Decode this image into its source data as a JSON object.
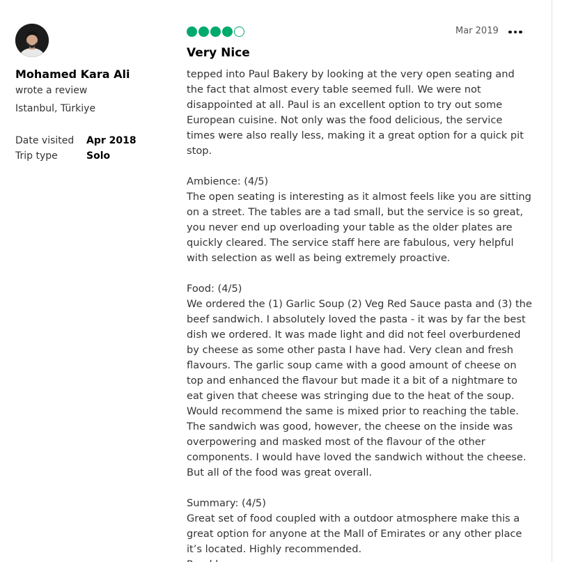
{
  "reviewer": {
    "name": "Mohamed Kara Ali",
    "action": "wrote a review",
    "location": "Istanbul, Türkiye",
    "avatar_icon": "user-avatar-photo",
    "details": [
      {
        "label": "Date visited",
        "value": "Apr 2018"
      },
      {
        "label": "Trip type",
        "value": "Solo"
      }
    ]
  },
  "review": {
    "rating": 4,
    "rating_max": 5,
    "rating_color": "#00aa6c",
    "date": "Mar 2019",
    "more_icon": "more-horizontal-icon",
    "title": "Very Nice",
    "paragraphs": [
      [
        "tepped into Paul Bakery by looking at the very open seating and",
        "the fact that almost every table seemed full. We were not",
        "disappointed at all. Paul is an excellent option to try out some",
        "European cuisine. Not only was the food delicious, the service",
        "times were also really less, making it a great option for a quick pit",
        "stop."
      ],
      [
        "Ambience: (4/5)",
        "The open seating is interesting as it almost feels like you are sitting",
        "on a street. The tables are a tad small, but the service is so great,",
        "you never end up overloading your table as the older plates are",
        "quickly cleared. The service staff here are fabulous, very helpful",
        "with selection as well as being extremely proactive."
      ],
      [
        "Food: (4/5)",
        "We ordered the (1) Garlic Soup (2) Veg Red Sauce pasta and (3) the",
        "beef sandwich. I absolutely loved the pasta - it was by far the best",
        "dish we ordered. It was made light and did not feel overburdened",
        "by cheese as some other pasta I have had. Very clean and fresh",
        "flavours. The garlic soup came with a good amount of cheese on",
        "top and enhanced the flavour but made it a bit of a nightmare to",
        "eat given that cheese was stringing due to the heat of the soup.",
        "Would recommend the same is mixed prior to reaching the table.",
        "The sandwich was good, however, the cheese on the inside was",
        "overpowering and masked most of the flavour of the other",
        "components. I would have loved the sandwich without the cheese.",
        "But all of the food was great overall."
      ],
      [
        "Summary: (4/5)",
        "Great set of food coupled with a outdoor atmosphere make this a",
        "great option for anyone at the Mall of Emirates or any other place",
        "it’s located. Highly recommended.",
        "Read less"
      ]
    ]
  }
}
